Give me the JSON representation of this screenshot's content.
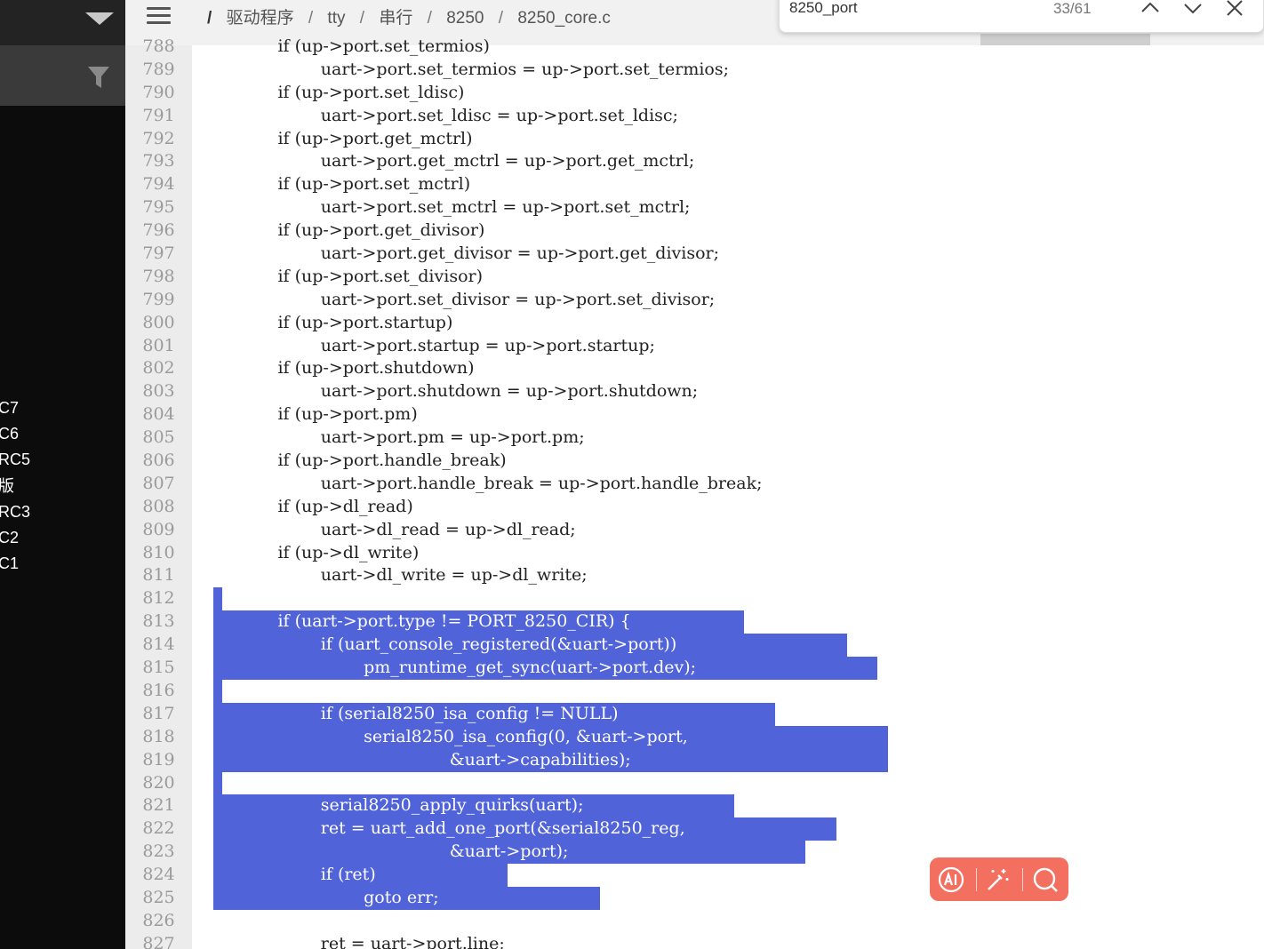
{
  "breadcrumb": {
    "items": [
      "驱动程序",
      "tty",
      "串行",
      "8250",
      "8250_core.c"
    ]
  },
  "find": {
    "query": "8250_port",
    "count": "33/61"
  },
  "sidebar": {
    "versions": [
      "C7",
      "C6",
      "RC5",
      "版",
      "RC3",
      "C2",
      "C1"
    ]
  },
  "editor": {
    "line_numbers": [
      "788",
      "789",
      "790",
      "791",
      "792",
      "793",
      "794",
      "795",
      "796",
      "797",
      "798",
      "799",
      "800",
      "801",
      "802",
      "803",
      "804",
      "805",
      "806",
      "807",
      "808",
      "809",
      "810",
      "811",
      "812",
      "813",
      "814",
      "815",
      "816",
      "817",
      "818",
      "819",
      "820",
      "821",
      "822",
      "823",
      "824",
      "825",
      "826",
      "827"
    ],
    "lines": [
      "            if (up->port.set_termios)",
      "                    uart->port.set_termios = up->port.set_termios;",
      "            if (up->port.set_ldisc)",
      "                    uart->port.set_ldisc = up->port.set_ldisc;",
      "            if (up->port.get_mctrl)",
      "                    uart->port.get_mctrl = up->port.get_mctrl;",
      "            if (up->port.set_mctrl)",
      "                    uart->port.set_mctrl = up->port.set_mctrl;",
      "            if (up->port.get_divisor)",
      "                    uart->port.get_divisor = up->port.get_divisor;",
      "            if (up->port.set_divisor)",
      "                    uart->port.set_divisor = up->port.set_divisor;",
      "            if (up->port.startup)",
      "                    uart->port.startup = up->port.startup;",
      "            if (up->port.shutdown)",
      "                    uart->port.shutdown = up->port.shutdown;",
      "            if (up->port.pm)",
      "                    uart->port.pm = up->port.pm;",
      "            if (up->port.handle_break)",
      "                    uart->port.handle_break = up->port.handle_break;",
      "            if (up->dl_read)",
      "                    uart->dl_read = up->dl_read;",
      "            if (up->dl_write)",
      "                    uart->dl_write = up->dl_write;",
      "",
      "            if (uart->port.type != PORT_8250_CIR) {",
      "                    if (uart_console_registered(&uart->port))",
      "                            pm_runtime_get_sync(uart->port.dev);",
      "",
      "                    if (serial8250_isa_config != NULL)",
      "                            serial8250_isa_config(0, &uart->port,",
      "                                            &uart->capabilities);",
      "",
      "                    serial8250_apply_quirks(uart);",
      "                    ret = uart_add_one_port(&serial8250_reg,",
      "                                            &uart->port);",
      "                    if (ret)",
      "                            goto err;",
      "",
      "                    ret = uart->port.line;"
    ]
  },
  "colors": {
    "selection": "#5063d8",
    "sidebar": "#0c0c0c",
    "gutter": "#ececec",
    "ai_toolbar": "#f36f5f"
  },
  "icons": {
    "menu": "hamburger-icon",
    "caret": "triangle-down-icon",
    "filter": "funnel-icon",
    "ai": "ai-icon",
    "magic": "magic-wand-icon",
    "search": "search-icon"
  }
}
